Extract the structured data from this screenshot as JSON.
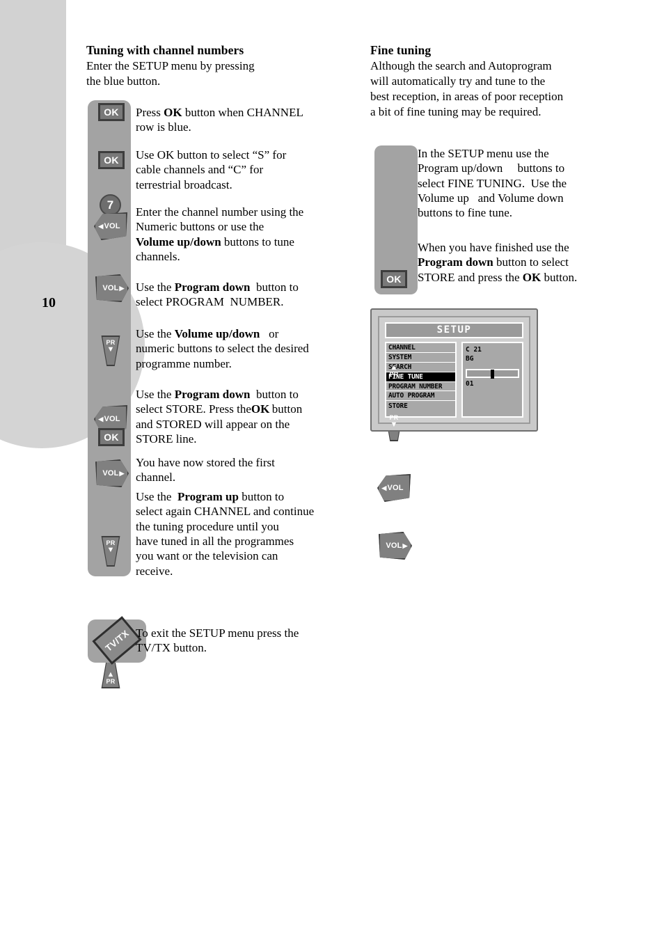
{
  "page": {
    "number": "10"
  },
  "left_column": {
    "heading": "Tuning with channel numbers",
    "intro_line1": "Enter the SETUP menu by pressing",
    "intro_line2": "the blue button.",
    "steps": [
      {
        "keys": [
          "OK"
        ],
        "text_parts": [
          "Press ",
          "OK",
          " button when CHANNEL row is blue."
        ]
      },
      {
        "keys": [
          "OK"
        ],
        "text_parts": [
          "Use OK button to select “S” for cable channels and “C” for terrestrial broadcast."
        ]
      },
      {
        "keys": [
          "7",
          "VOL-left",
          "VOL-right"
        ],
        "text_parts": [
          "Enter the channel number using the Numeric buttons or use the ",
          "Volume up/down",
          " buttons to tune channels."
        ]
      },
      {
        "keys": [
          "PR-down"
        ],
        "text_parts": [
          "Use the ",
          "Program down",
          " button to select PROGRAM  NUMBER."
        ]
      },
      {
        "keys": [
          "VOL-left",
          "VOL-right"
        ],
        "text_parts": [
          "Use the ",
          "Volume up/down",
          "  or numeric buttons to select the desired programme number."
        ]
      },
      {
        "keys": [
          "PR-down",
          "OK"
        ],
        "text_parts": [
          "Use the ",
          "Program down",
          " button to select STORE. Press the",
          "OK",
          " button and STORED will appear on the STORE line."
        ]
      },
      {
        "keys": [],
        "text_parts": [
          "You have now stored the first channel."
        ]
      },
      {
        "keys": [
          "PR-up"
        ],
        "text_parts": [
          "Use the ",
          "Program up",
          " button to select again CHANNEL and continue the tuning procedure until you have tuned in all the programmes you want or the television can receive."
        ]
      }
    ],
    "exit_step": {
      "key_label": "TV/TX",
      "text": "To exit the SETUP menu press the TV/TX button."
    }
  },
  "right_column": {
    "heading": "Fine   tuning",
    "intro": "Although the search and Autoprogram will automatically try and tune to the best reception, in areas of poor reception a bit of fine tuning may be required.",
    "keys": [
      "PR-up",
      "PR-down",
      "VOL-left",
      "VOL-right",
      "OK"
    ],
    "para1_parts": [
      "In the SETUP menu use the Program up/down     buttons to select FINE TUNING.  Use the Volume up   and Volume down buttons to fine tune."
    ],
    "para2_parts": [
      "When you have finished use the ",
      "Program down",
      " button to select STORE and press the ",
      "OK",
      " button."
    ]
  },
  "osd": {
    "title": "SETUP",
    "menu_items": [
      {
        "label": "CHANNEL",
        "selected": false
      },
      {
        "label": "SYSTEM",
        "selected": false
      },
      {
        "label": "SEARCH",
        "selected": false
      },
      {
        "label": "FINE TUNE",
        "selected": true
      },
      {
        "label": "PROGRAM NUMBER",
        "selected": false
      },
      {
        "label": "AUTO PROGRAM",
        "selected": false
      },
      {
        "label": "STORE",
        "selected": false
      }
    ],
    "channel_value": "C 21",
    "system_value": "BG",
    "program_number": "01",
    "slider_position_pct": 47
  },
  "key_labels": {
    "ok": "OK",
    "num7": "7",
    "vol": "VOL",
    "pr": "PR",
    "tvtx": "TV/TX"
  },
  "colors": {
    "rail": "#a3a3a3",
    "deco": "#d2d2d2",
    "key_face": "#808080",
    "key_border": "#3f3f3f",
    "osd_selected": "#000000"
  }
}
